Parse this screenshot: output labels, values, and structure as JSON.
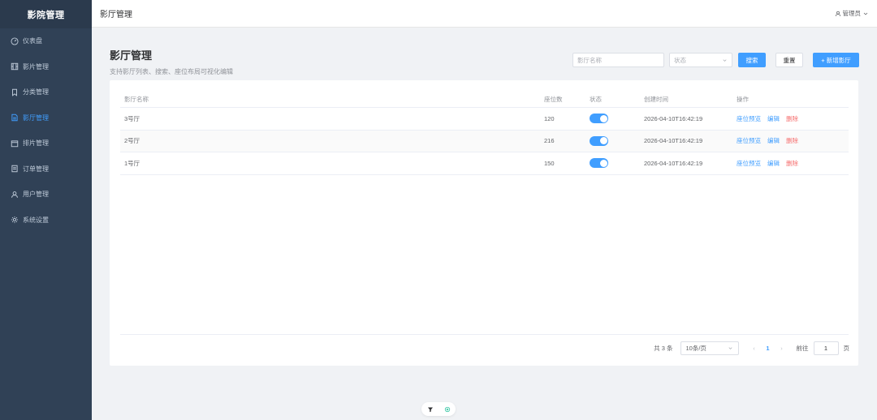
{
  "app": {
    "logo": "影院管理"
  },
  "sidebar": {
    "items": [
      {
        "label": "仪表盘",
        "icon": "dashboard-icon"
      },
      {
        "label": "影片管理",
        "icon": "film-icon"
      },
      {
        "label": "分类管理",
        "icon": "bookmark-icon"
      },
      {
        "label": "影厅管理",
        "icon": "document-icon",
        "active": true
      },
      {
        "label": "排片管理",
        "icon": "calendar-icon"
      },
      {
        "label": "订单管理",
        "icon": "order-icon"
      },
      {
        "label": "用户管理",
        "icon": "user-icon"
      },
      {
        "label": "系统设置",
        "icon": "gear-icon"
      }
    ]
  },
  "topbar": {
    "title": "影厅管理",
    "user": "管理员"
  },
  "page": {
    "title": "影厅管理",
    "subtitle": "支持影厅列表、搜索、座位布局可视化编辑"
  },
  "filters": {
    "name_placeholder": "影厅名称",
    "status_placeholder": "状态",
    "search_label": "搜索",
    "reset_label": "重置",
    "add_label": "+ 新增影厅"
  },
  "table": {
    "headers": {
      "name": "影厅名称",
      "seats": "座位数",
      "status": "状态",
      "created": "创建时间",
      "ops": "操作"
    },
    "rows": [
      {
        "name": "3号厅",
        "seats": "120",
        "enabled": true,
        "created": "2026-04-10T16:42:19"
      },
      {
        "name": "2号厅",
        "seats": "216",
        "enabled": true,
        "created": "2026-04-10T16:42:19"
      },
      {
        "name": "1号厅",
        "seats": "150",
        "enabled": true,
        "created": "2026-04-10T16:42:19"
      }
    ],
    "ops": {
      "preview": "座位预览",
      "edit": "编辑",
      "delete": "删除"
    }
  },
  "pagination": {
    "total": "共 3 条",
    "page_size": "10条/页",
    "current_page": "1",
    "goto_label": "前往",
    "goto_value": "1",
    "page_unit": "页"
  },
  "colors": {
    "primary": "#409eff",
    "danger": "#f56c6c",
    "sidebar_bg": "#304156"
  }
}
